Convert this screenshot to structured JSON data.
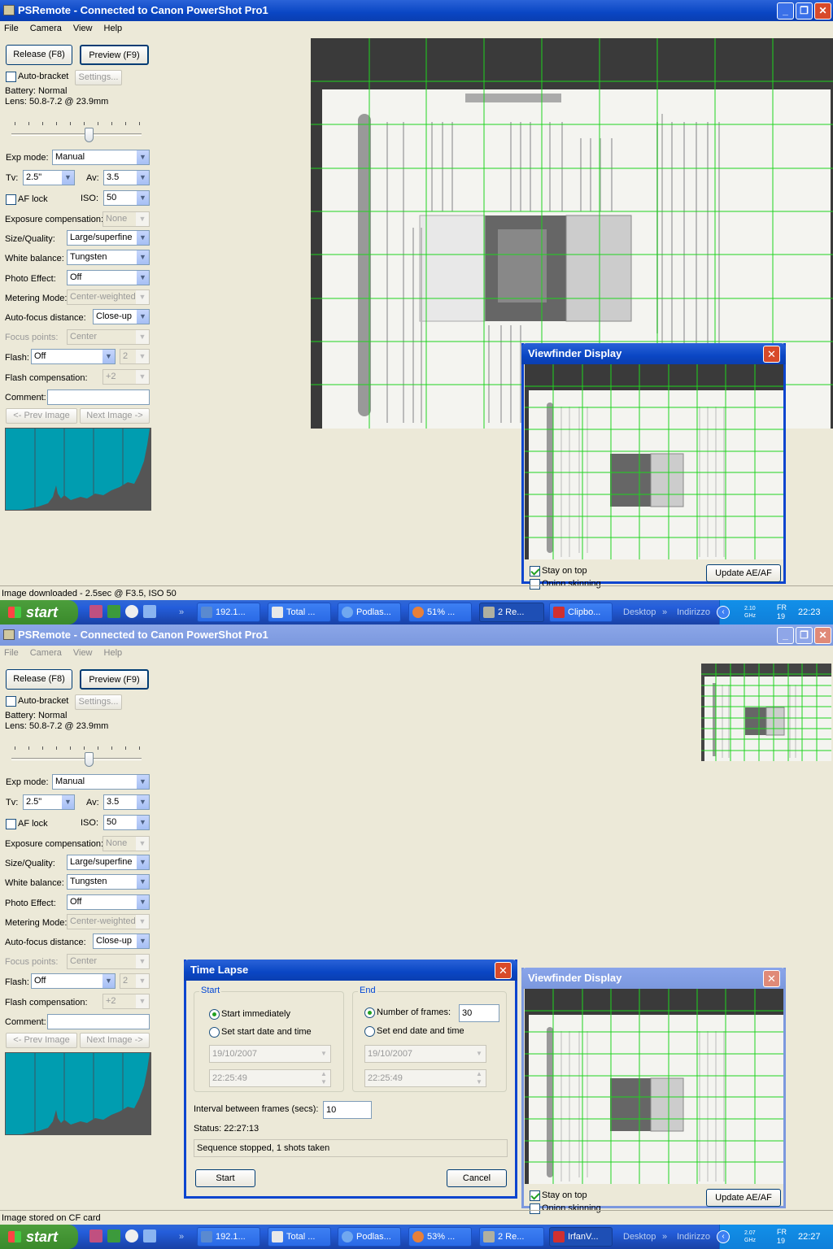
{
  "app": {
    "title": "PSRemote - Connected to Canon PowerShot Pro1",
    "menu": [
      "File",
      "Camera",
      "View",
      "Help"
    ]
  },
  "controls": {
    "release": "Release (F8)",
    "preview": "Preview (F9)",
    "auto_bracket": "Auto-bracket",
    "settings": "Settings...",
    "battery": "Battery: Normal",
    "lens": "Lens: 50.8-7.2 @ 23.9mm",
    "exp_mode_label": "Exp mode:",
    "exp_mode": "Manual",
    "tv_label": "Tv:",
    "tv": "2.5\"",
    "av_label": "Av:",
    "av": "3.5",
    "af_lock": "AF lock",
    "iso_label": "ISO:",
    "iso": "50",
    "exp_comp_label": "Exposure compensation:",
    "exp_comp": "None",
    "size_label": "Size/Quality:",
    "size": "Large/superfine",
    "wb_label": "White balance:",
    "wb": "Tungsten",
    "effect_label": "Photo Effect:",
    "effect": "Off",
    "metering_label": "Metering Mode:",
    "metering": "Center-weighted",
    "af_dist_label": "Auto-focus distance:",
    "af_dist": "Close-up",
    "focus_label": "Focus points:",
    "focus": "Center",
    "flash_label": "Flash:",
    "flash": "Off",
    "flash_n": "2",
    "flash_comp_label": "Flash compensation:",
    "flash_comp": "+2",
    "comment_label": "Comment:",
    "prev_image": "<- Prev Image",
    "next_image": "Next Image ->",
    "zoom_level": 0.55
  },
  "status": {
    "top": "Image downloaded - 2.5sec @ F3.5, ISO 50",
    "bottom": "Image stored on CF card"
  },
  "viewfinder": {
    "title": "Viewfinder Display",
    "stay_on_top": "Stay on top",
    "onion": "Onion skinning",
    "update": "Update AE/AF"
  },
  "timelapse": {
    "title": "Time Lapse",
    "start_group": "Start",
    "start_immediately": "Start immediately",
    "set_start": "Set start date and time",
    "start_date": "19/10/2007",
    "start_time": "22:25:49",
    "end_group": "End",
    "num_frames_label": "Number of frames:",
    "num_frames": "30",
    "set_end": "Set end date and time",
    "end_date": "19/10/2007",
    "end_time": "22:25:49",
    "interval_label": "Interval between frames (secs):",
    "interval": "10",
    "status": "Status: 22:27:13",
    "message": "Sequence stopped, 1 shots taken",
    "start_btn": "Start",
    "cancel_btn": "Cancel"
  },
  "taskbar": {
    "start": "start",
    "tasks_top": [
      "192.1...",
      "Total ...",
      "Podlas...",
      "51% ...",
      "2 Re...",
      "Clipbo..."
    ],
    "tasks_bottom": [
      "192.1...",
      "Total ...",
      "Podlas...",
      "53% ...",
      "2 Re...",
      "IrfanV..."
    ],
    "desktop": "Desktop",
    "address": "Indirizzo",
    "ghz_top": "2.10 GHz",
    "ghz_bottom": "2.07 GHz",
    "day": "FR 19",
    "clock_top": "22:23",
    "clock_bottom": "22:27"
  }
}
